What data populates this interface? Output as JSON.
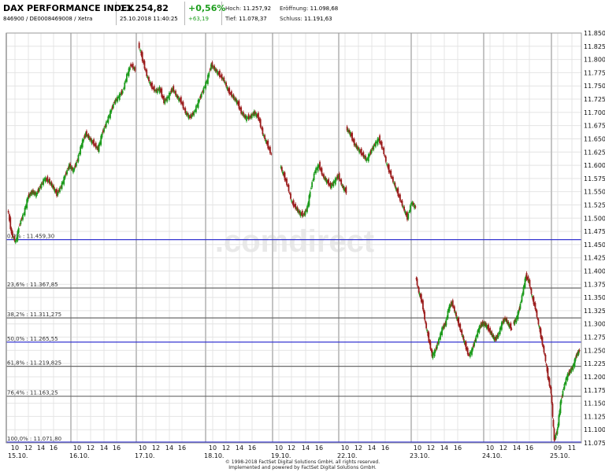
{
  "header": {
    "name": "DAX PERFORMANCE INDEX",
    "ids": "846900 / DE0008469008 / Xetra",
    "price": "11.254,82",
    "datetime": "25.10.2018 11:40:25",
    "change_pct": "+0,56%",
    "change_abs": "+63,19",
    "hoch_label": "Hoch:",
    "hoch": "11.257,92",
    "eroeffnung_label": "Eröffnung:",
    "eroeffnung": "11.098,68",
    "tief_label": "Tief:",
    "tief": "11.078,37",
    "schluss_label": "Schluss:",
    "schluss": "11.191,63"
  },
  "watermark": ".comdirect",
  "footer": {
    "line1": "© 1998-2018 FactSet Digital Solutions GmbH, all rights reserved.",
    "line2": "Implemented and powered by FactSet Digital Solutions GmbH."
  },
  "colors": {
    "up": "#1a9a1a",
    "down": "#9b1c1c",
    "blue_line": "#3535d0",
    "gray_line": "#6a6a6a",
    "grid": "#e4e4e4",
    "day_sep": "#c4c4c4"
  },
  "chart_data": {
    "type": "candlestick",
    "title": "",
    "ylim": [
      11075,
      11850
    ],
    "y_ticks": [
      "11.850",
      "11.825",
      "11.800",
      "11.775",
      "11.750",
      "11.725",
      "11.700",
      "11.675",
      "11.650",
      "11.625",
      "11.600",
      "11.575",
      "11.550",
      "11.525",
      "11.500",
      "11.475",
      "11.450",
      "11.425",
      "11.400",
      "11.375",
      "11.350",
      "11.325",
      "11.300",
      "11.275",
      "11.250",
      "11.225",
      "11.200",
      "11.175",
      "11.150",
      "11.125",
      "11.100",
      "11.075"
    ],
    "y_tick_values": [
      11850,
      11825,
      11800,
      11775,
      11750,
      11725,
      11700,
      11675,
      11650,
      11625,
      11600,
      11575,
      11550,
      11525,
      11500,
      11475,
      11450,
      11425,
      11400,
      11375,
      11350,
      11325,
      11300,
      11275,
      11250,
      11225,
      11200,
      11175,
      11150,
      11125,
      11100,
      11075
    ],
    "x_hour_labels": [
      "10",
      "12",
      "14",
      "16",
      "10",
      "12",
      "14",
      "16",
      "10",
      "12",
      "14",
      "16",
      "10",
      "12",
      "14",
      "16",
      "10",
      "12",
      "14",
      "16",
      "10",
      "12",
      "14",
      "16",
      "10",
      "12",
      "14",
      "16",
      "10",
      "12",
      "14",
      "16",
      "09",
      "11"
    ],
    "x_day_labels": [
      "15.10.",
      "16.10.",
      "17.10.",
      "18.10.",
      "19.10.",
      "22.10.",
      "23.10.",
      "24.10.",
      "25.10."
    ],
    "fib_levels": [
      {
        "label": "0,0% : 11.459,30",
        "value": 11459.3,
        "style": "blue"
      },
      {
        "label": "23,6% : 11.367,85",
        "value": 11367.85,
        "style": "gray"
      },
      {
        "label": "38,2% : 11.311,275",
        "value": 11311.275,
        "style": "gray"
      },
      {
        "label": "50,0% : 11.265,55",
        "value": 11265.55,
        "style": "blue"
      },
      {
        "label": "61,8% : 11.219,825",
        "value": 11219.825,
        "style": "gray"
      },
      {
        "label": "76,4% : 11.163,25",
        "value": 11163.25,
        "style": "gray"
      },
      {
        "label": "100,0% : 11.071,80",
        "value": 11071.8,
        "style": "blue"
      }
    ],
    "series": [
      {
        "values": [
          11520,
          11470,
          11455,
          11490,
          11510,
          11540,
          11550,
          11545,
          11560,
          11575,
          11570,
          11560,
          11545,
          11560,
          11580,
          11600,
          11590,
          11610,
          11640,
          11660,
          11650,
          11640,
          11630,
          11660,
          11680,
          11700,
          11720,
          11730,
          11740,
          11770,
          11790,
          11780
        ]
      },
      {
        "values": [
          11830,
          11800,
          11770,
          11750,
          11740,
          11745,
          11720,
          11730,
          11745,
          11730,
          11720,
          11700,
          11690,
          11700,
          11720,
          11740,
          11760,
          11790,
          11780,
          11770,
          11760,
          11740,
          11730,
          11720,
          11700,
          11690,
          11690,
          11700,
          11690,
          11660,
          11640,
          11620
        ]
      },
      {
        "values": [
          11600,
          11580,
          11560,
          11530,
          11520,
          11510,
          11505,
          11520,
          11560,
          11590,
          11600,
          11580,
          11570,
          11560,
          11570,
          11580,
          11560,
          11550
        ]
      },
      {
        "values": [
          11670,
          11660,
          11640,
          11630,
          11620,
          11610,
          11625,
          11640,
          11650,
          11630,
          11600,
          11580,
          11560,
          11540,
          11520,
          11500,
          11530,
          11520
        ]
      },
      {
        "values": [
          11390,
          11360,
          11340,
          11300,
          11270,
          11240,
          11250,
          11270,
          11290,
          11300,
          11330,
          11340,
          11320,
          11300,
          11280,
          11260,
          11240,
          11250,
          11270,
          11290,
          11300,
          11300,
          11290,
          11280,
          11270,
          11280,
          11300,
          11310,
          11300,
          11290
        ]
      },
      {
        "values": [
          11300,
          11310,
          11330,
          11360,
          11390,
          11380,
          11350,
          11330,
          11300,
          11270,
          11240,
          11200,
          11170,
          11080,
          11100,
          11150,
          11180,
          11200,
          11210,
          11220,
          11240,
          11250
        ]
      }
    ]
  }
}
